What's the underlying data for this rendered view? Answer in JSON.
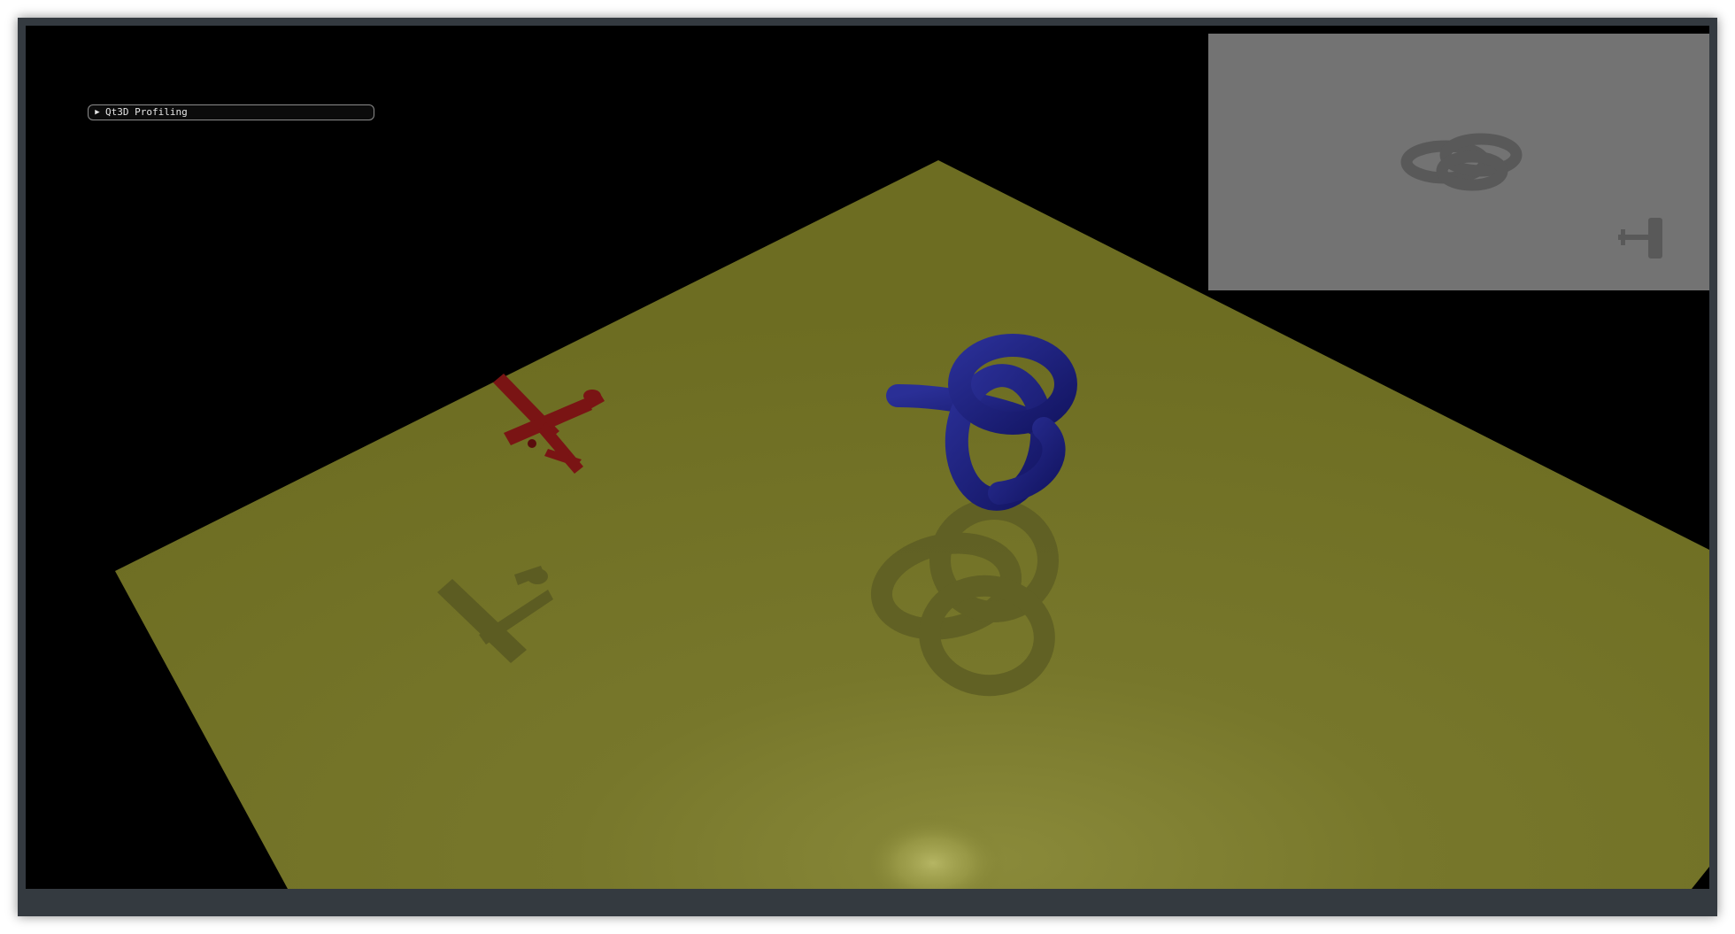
{
  "window": {
    "title": ""
  },
  "profiler": {
    "label": "Qt3D Profiling",
    "expand_icon": "triangle-right-icon",
    "expanded": false
  },
  "scene": {
    "background_color": "#000000",
    "ground_color": "#7f7f2a",
    "light_highlight_color": "#a6a654",
    "airplane_color": "#7a1414",
    "knot_color": "#1c1f78",
    "shadow_color": "#5b5b22"
  },
  "minimap": {
    "background_color": "#737373",
    "shadow_color": "#565656"
  }
}
